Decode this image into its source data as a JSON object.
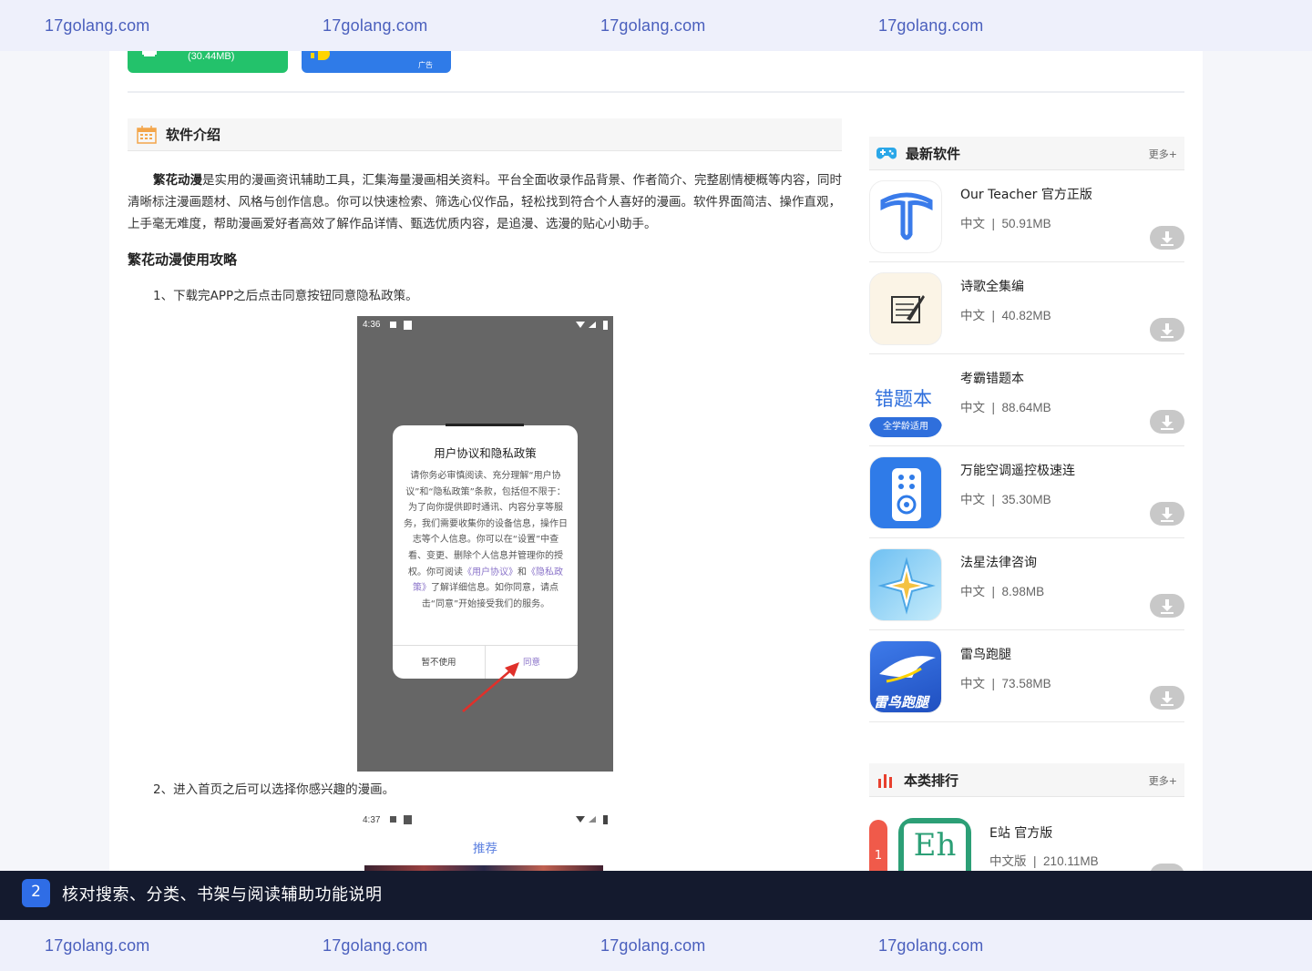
{
  "watermarks": [
    "17golang.com",
    "17golang.com",
    "17golang.com",
    "17golang.com"
  ],
  "download": {
    "green_size": "(30.44MB)",
    "blue_ad": "广告"
  },
  "intro": {
    "section_title": "软件介绍",
    "app_name": "繁花动漫",
    "text": "是实用的漫画资讯辅助工具，汇集海量漫画相关资料。平台全面收录作品背景、作者简介、完整剧情梗概等内容，同时清晰标注漫画题材、风格与创作信息。你可以快速检索、筛选心仪作品，轻松找到符合个人喜好的漫画。软件界面简洁、操作直观，上手毫无难度，帮助漫画爱好者高效了解作品详情、甄选优质内容，是追漫、选漫的贴心小助手。",
    "guide_title": "繁花动漫使用攻略",
    "step1": "1、下载完APP之后点击同意按钮同意隐私政策。",
    "step2": "2、进入首页之后可以选择你感兴趣的漫画。"
  },
  "screenshot1": {
    "time": "4:36",
    "dialog_title": "用户协议和隐私政策",
    "dialog_body_1": "请你务必审慎阅读、充分理解“用户协议”和“隐私政策”条款，包括但不限于：为了向你提供即时通讯、内容分享等服务，我们需要收集你的设备信息，操作日志等个人信息。你可以在“设置”中查看、变更、删除个人信息并管理你的授权。你可阅读",
    "link_user": "《用户协议》",
    "and": "和",
    "link_privacy": "《隐私政策》",
    "dialog_body_2": "了解详细信息。如你同意，请点击“同意”开始接受我们的服务。",
    "btn_decline": "暂不使用",
    "btn_agree": "同意"
  },
  "screenshot2": {
    "time": "4:37",
    "tab": "推荐"
  },
  "latest": {
    "title": "最新软件",
    "more": "更多+",
    "apps": [
      {
        "name": "Our Teacher 官方正版",
        "lang": "中文",
        "size": "50.91MB"
      },
      {
        "name": "诗歌全集编",
        "lang": "中文",
        "size": "40.82MB"
      },
      {
        "name": "考霸错题本",
        "lang": "中文",
        "size": "88.64MB",
        "icon_text": "错题本",
        "icon_badge": "全学龄适用"
      },
      {
        "name": "万能空调遥控极速连",
        "lang": "中文",
        "size": "35.30MB"
      },
      {
        "name": "法星法律咨询",
        "lang": "中文",
        "size": "8.98MB"
      },
      {
        "name": "雷鸟跑腿",
        "lang": "中文",
        "size": "73.58MB",
        "icon_text": "雷鸟跑腿"
      }
    ]
  },
  "ranking": {
    "title": "本类排行",
    "more": "更多+",
    "items": [
      {
        "rank": "1",
        "name": "E站 官方版",
        "lang": "中文版",
        "size": "210.11MB",
        "icon_text": "Eh"
      }
    ]
  },
  "caption": {
    "num": "2",
    "text": "核对搜索、分类、书架与阅读辅助功能说明"
  },
  "separator": "|"
}
